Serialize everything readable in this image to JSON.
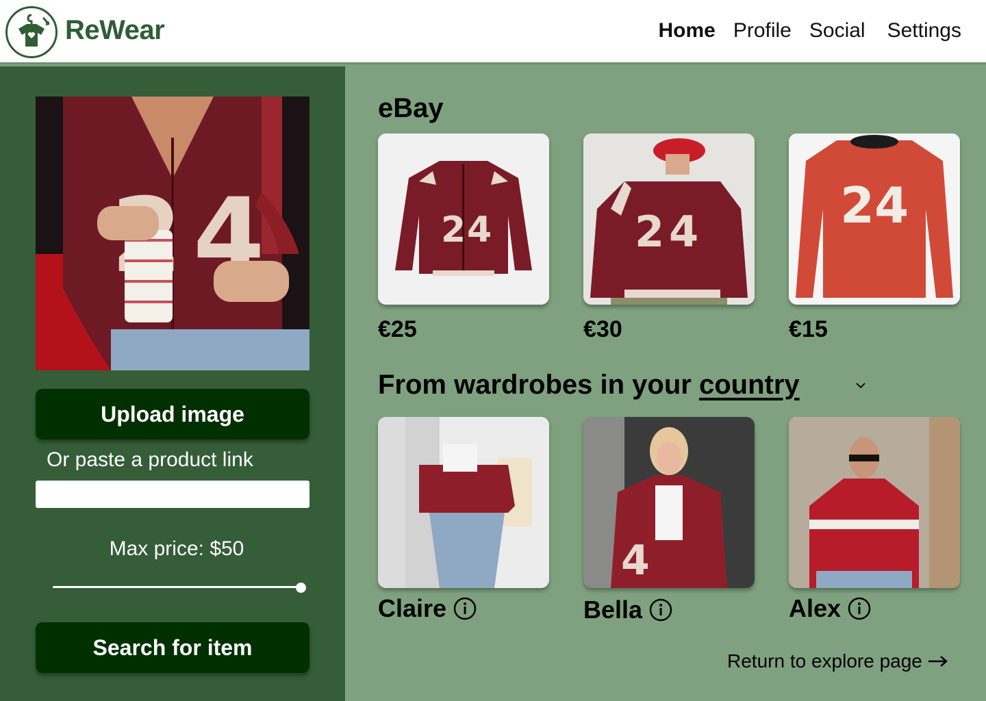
{
  "app": {
    "name": "ReWear"
  },
  "nav": {
    "home": "Home",
    "profile": "Profile",
    "social": "Social",
    "settings": "Settings"
  },
  "sidebar": {
    "upload_button": "Upload image",
    "paste_label": "Or paste a product link",
    "link_value": "",
    "max_price_label": "Max price: $50",
    "max_price_fraction": 1.0,
    "search_button": "Search for item"
  },
  "ebay": {
    "title": "eBay",
    "items": [
      {
        "price": "€25",
        "image": "maroon-varsity-jacket-24"
      },
      {
        "price": "€30",
        "image": "model-wearing-varsity-jacket-24"
      },
      {
        "price": "€15",
        "image": "red-sweatshirt-24"
      }
    ]
  },
  "wardrobes": {
    "title_prefix": "From wardrobes in your ",
    "title_link": "country",
    "people": [
      {
        "name": "Claire",
        "image": "claire-wearing-red-jacket"
      },
      {
        "name": "Bella",
        "image": "bella-wearing-red-jacket"
      },
      {
        "name": "Alex",
        "image": "alex-wearing-red-jersey"
      }
    ]
  },
  "footer": {
    "return_link": "Return to explore page"
  },
  "colors": {
    "brand_green": "#2f5d34",
    "sidebar_green": "#345d38",
    "main_green": "#7fa17f",
    "button_dark": "#003000",
    "jacket_maroon": "#7a1c27"
  }
}
